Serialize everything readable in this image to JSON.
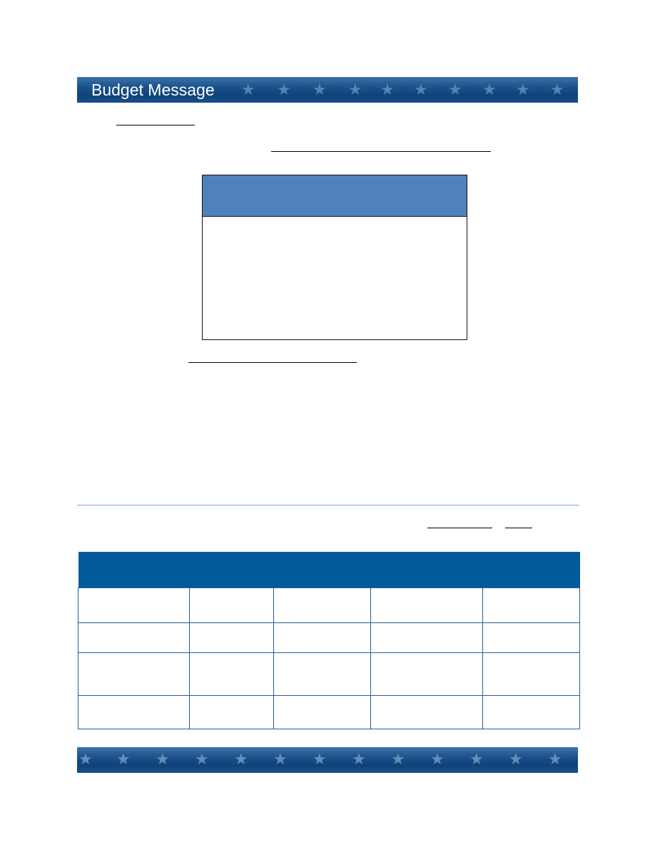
{
  "header": {
    "title": "Budget Message"
  },
  "footer": {},
  "table": {
    "columns": 5,
    "rows": 4
  }
}
